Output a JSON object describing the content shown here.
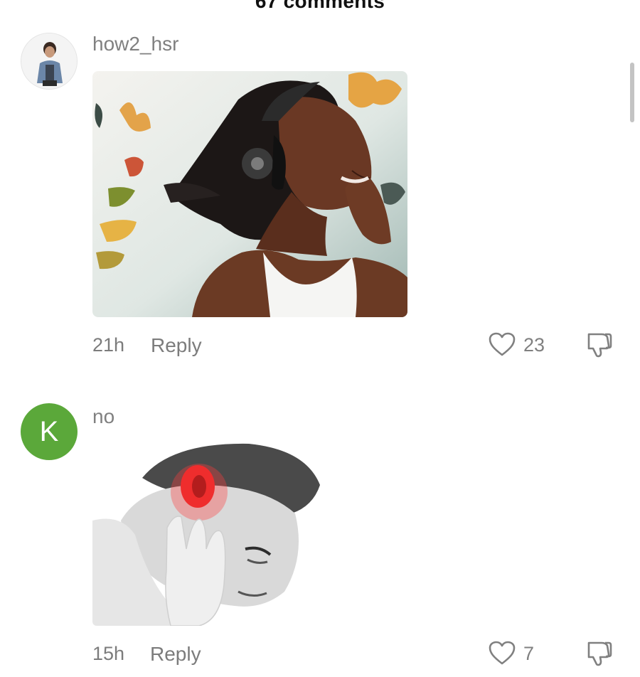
{
  "header": {
    "title": "67 comments"
  },
  "comments": [
    {
      "username": "how2_hsr",
      "avatar": {
        "kind": "photo",
        "icon": "user-photo-avatar"
      },
      "media": {
        "kind": "gif",
        "icon": "woman-headphones-butterflies-image"
      },
      "time": "21h",
      "reply_label": "Reply",
      "likes": "23"
    },
    {
      "username": "no",
      "avatar": {
        "kind": "letter",
        "letter": "K",
        "color": "#5ba83a"
      },
      "media": {
        "kind": "gif",
        "icon": "man-ear-pain-image"
      },
      "time": "15h",
      "reply_label": "Reply",
      "likes": "7"
    }
  ],
  "colors": {
    "secondary_text": "#808080",
    "title_text": "#111111",
    "avatar_green": "#5ba83a",
    "scrollbar": "#c4c4c4"
  }
}
